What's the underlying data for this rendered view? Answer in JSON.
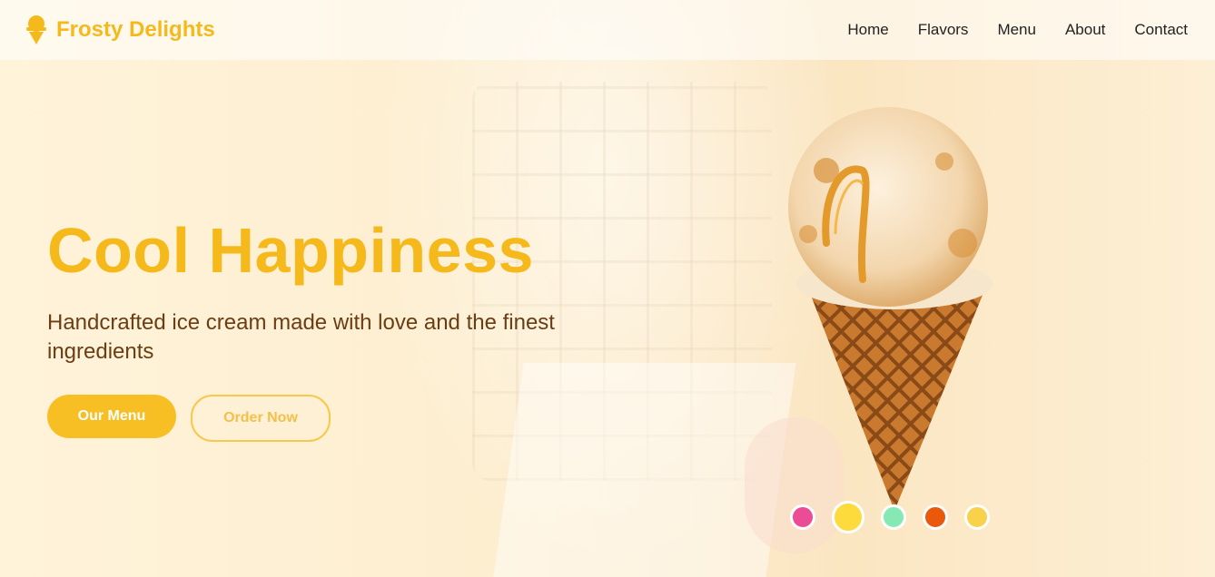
{
  "brand": {
    "name": "Frosty Delights",
    "accent": "#f5b91c"
  },
  "nav": {
    "items": [
      "Home",
      "Flavors",
      "Menu",
      "About",
      "Contact"
    ]
  },
  "hero": {
    "title": "Cool Happiness",
    "subtitle": "Handcrafted ice cream made with love and the finest ingredients",
    "primary_button": "Our Menu",
    "secondary_button": "Order Now"
  },
  "flavor_dots": [
    {
      "color": "#ec4c96",
      "active": false
    },
    {
      "color": "#fddb3d",
      "active": true
    },
    {
      "color": "#86e9b3",
      "active": false
    },
    {
      "color": "#ea580c",
      "active": false
    },
    {
      "color": "#fad14a",
      "active": false
    }
  ],
  "icons": {
    "logo": "ice-cream-icon"
  }
}
